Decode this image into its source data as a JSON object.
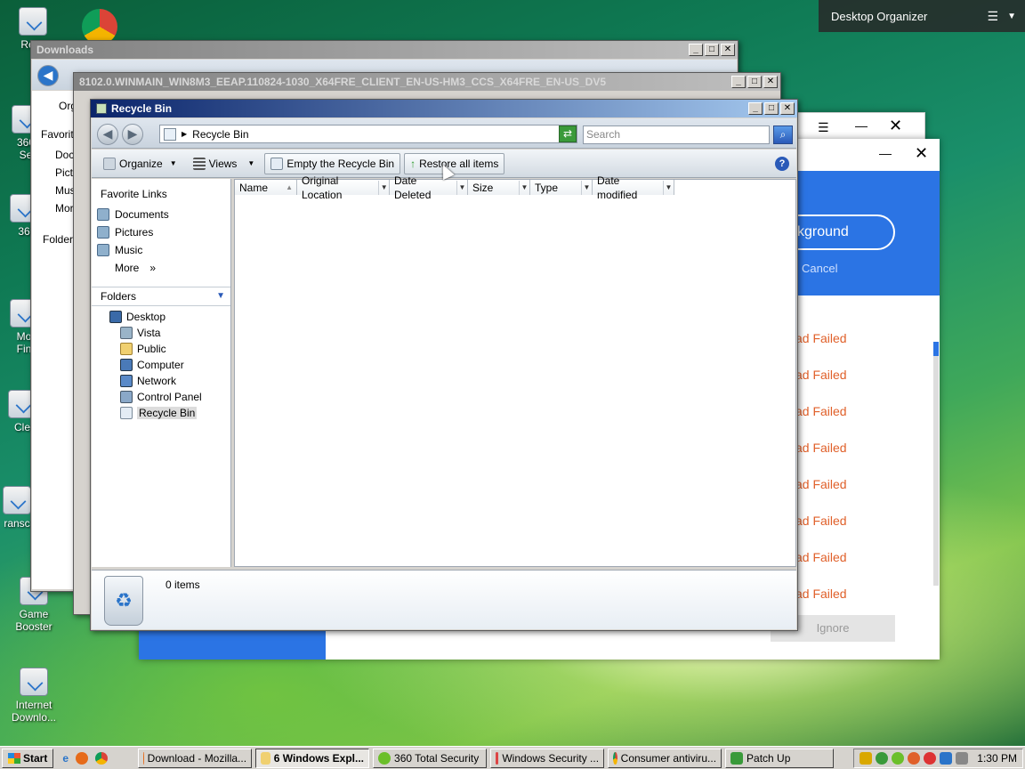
{
  "desktop": {
    "icons": [
      {
        "label": "Recy"
      },
      {
        "label": "360\nSe"
      },
      {
        "label": "36"
      },
      {
        "label": "Mo\nFin"
      },
      {
        "label": "Cle"
      },
      {
        "label": "ransc"
      },
      {
        "label": "Game\nBooster"
      },
      {
        "label": "Internet\nDownlo..."
      }
    ]
  },
  "organizer": {
    "title": "Desktop Organizer"
  },
  "app360": {
    "button_primary": "ckground",
    "cancel": "Cancel",
    "fail_items": [
      "ad Failed",
      "ad Failed",
      "ad Failed",
      "ad Failed",
      "ad Failed",
      "ad Failed",
      "ad Failed",
      "ad Failed"
    ],
    "ignore": "Ignore"
  },
  "bg_windows": {
    "downloads_title": "Downloads",
    "build_title": "8102.0.WINMAIN_WIN8M3_EEAP.110824-1030_X64FRE_CLIENT_EN-US-HM3_CCS_X64FRE_EN-US_DV5",
    "partial_nav": [
      "Favorit",
      "Doc",
      "Pict",
      "Mus",
      "Mor",
      "Folder"
    ],
    "partial_org": "Org"
  },
  "recycle_bin": {
    "title": "Recycle Bin",
    "address": "Recycle Bin",
    "search_placeholder": "Search",
    "toolbar": {
      "organize": "Organize",
      "views": "Views",
      "empty": "Empty the Recycle Bin",
      "restore": "Restore all items"
    },
    "favorite_links_header": "Favorite Links",
    "favorite_links": [
      "Documents",
      "Pictures",
      "Music"
    ],
    "more": "More",
    "folders_header": "Folders",
    "folders": [
      "Desktop",
      "Vista",
      "Public",
      "Computer",
      "Network",
      "Control Panel",
      "Recycle Bin"
    ],
    "columns": [
      "Name",
      "Original Location",
      "Date Deleted",
      "Size",
      "Type",
      "Date modified"
    ],
    "status": "0 items"
  },
  "taskbar": {
    "start": "Start",
    "tasks": [
      {
        "label": "Download - Mozilla..."
      },
      {
        "label": "6 Windows Expl..."
      },
      {
        "label": "360 Total Security"
      },
      {
        "label": "Windows Security ..."
      },
      {
        "label": "Consumer antiviru..."
      },
      {
        "label": "Patch Up"
      }
    ],
    "clock": "1:30 PM"
  },
  "colors": {
    "title_active": "#0a246a",
    "accent_360": "#2b74e4",
    "fail": "#e0602a"
  }
}
